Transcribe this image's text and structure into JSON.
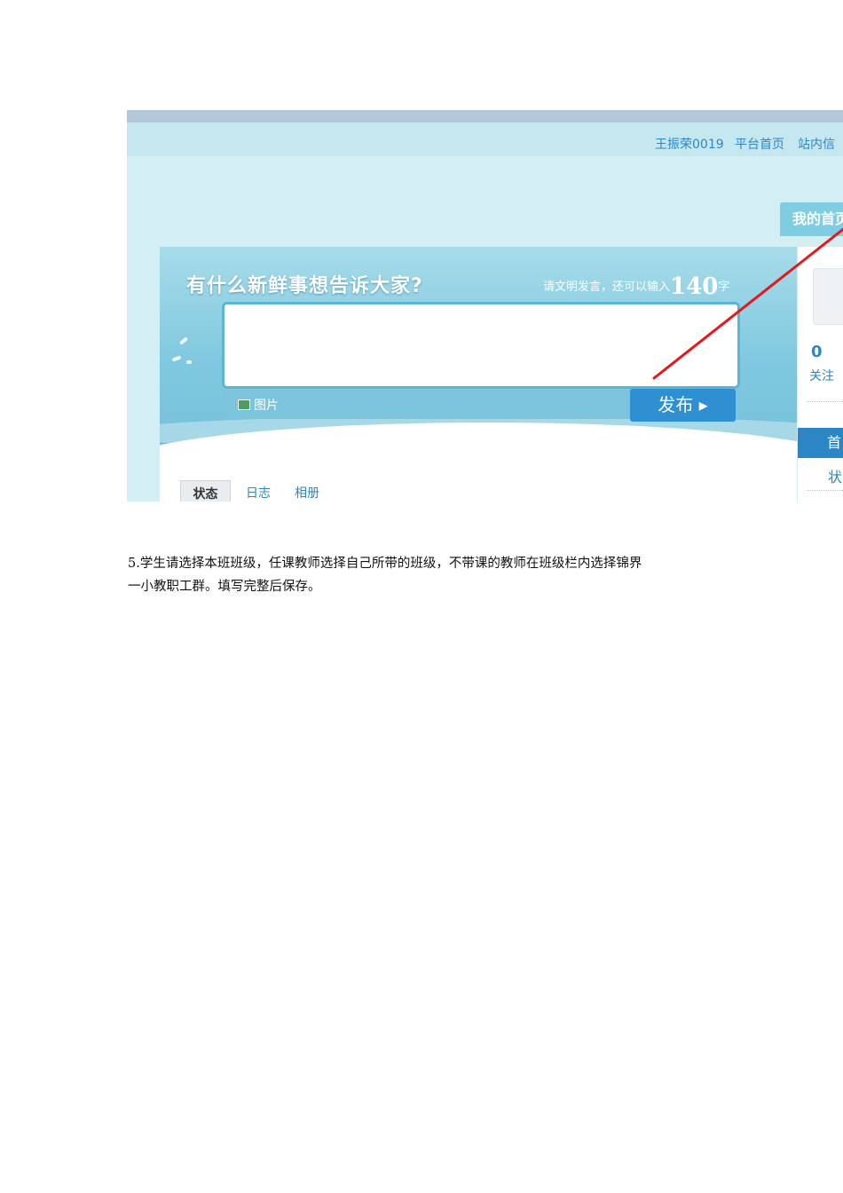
{
  "screenshot": {
    "top_links": [
      "王振荣0019",
      "平台首页",
      "站内信"
    ],
    "my_page_tab": "我的首页",
    "slogan": "有什么新鲜事想告诉大家?",
    "counter_prefix": "请文明发言，还可以输入",
    "counter_number": "140",
    "counter_unit": "字",
    "image_button": "图片",
    "publish_button": "发布 ▸",
    "tabs": [
      "状态",
      "日志",
      "相册"
    ],
    "follow_count": "0",
    "follow_label": "关注",
    "nav_home": "首",
    "nav_status": "状",
    "colors": {
      "header_link": "#2c86c6",
      "publish_button": "#2e8fd1",
      "arrow": "#e3191e",
      "background": "#d3eff4"
    }
  },
  "document": {
    "paragraph_line1": "5.学生请选择本班班级，任课教师选择自己所带的班级，不带课的教师在班级栏内选择锦界",
    "paragraph_line2": "一小教职工群。填写完整后保存。"
  }
}
